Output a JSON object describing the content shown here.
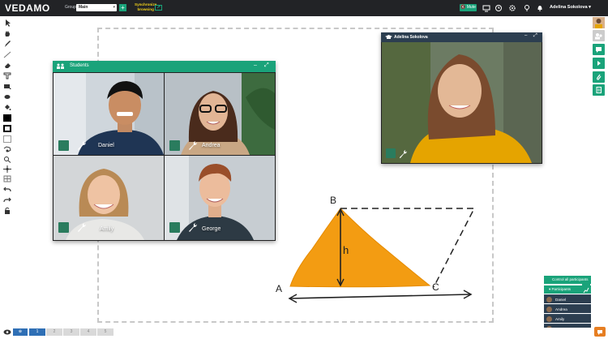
{
  "app": {
    "logo": "VEDAMO"
  },
  "header": {
    "group_label": "Group:",
    "group_value": "Main",
    "sync_line1": "Synchronize",
    "sync_line2": "browsing",
    "mute_label": "Mute",
    "user_name": "Adelina Sokolova ▾"
  },
  "students_panel": {
    "title": "Students",
    "tiles": [
      {
        "name": "Daniel"
      },
      {
        "name": "Andrea"
      },
      {
        "name": "Amily"
      },
      {
        "name": "George"
      }
    ]
  },
  "teacher_panel": {
    "title": "Adelina Sokolova"
  },
  "drawing": {
    "label_a": "A",
    "label_b": "B",
    "label_c": "C",
    "label_h": "h",
    "colors": {
      "triangle": "#f39c12",
      "stroke": "#222222"
    }
  },
  "bottom": {
    "pages": [
      "1",
      "2",
      "3",
      "4",
      "5"
    ],
    "active_page": "1"
  },
  "participants": {
    "control_all_label": "Control all participants",
    "participants_label": "▾ Participants",
    "items": [
      {
        "name": "Daniel"
      },
      {
        "name": "Andrea"
      },
      {
        "name": "Amily"
      },
      {
        "name": "George"
      }
    ]
  },
  "colors": {
    "accent": "#1aa37a",
    "topbar": "#222326",
    "panel_header": "#2c3e50"
  }
}
